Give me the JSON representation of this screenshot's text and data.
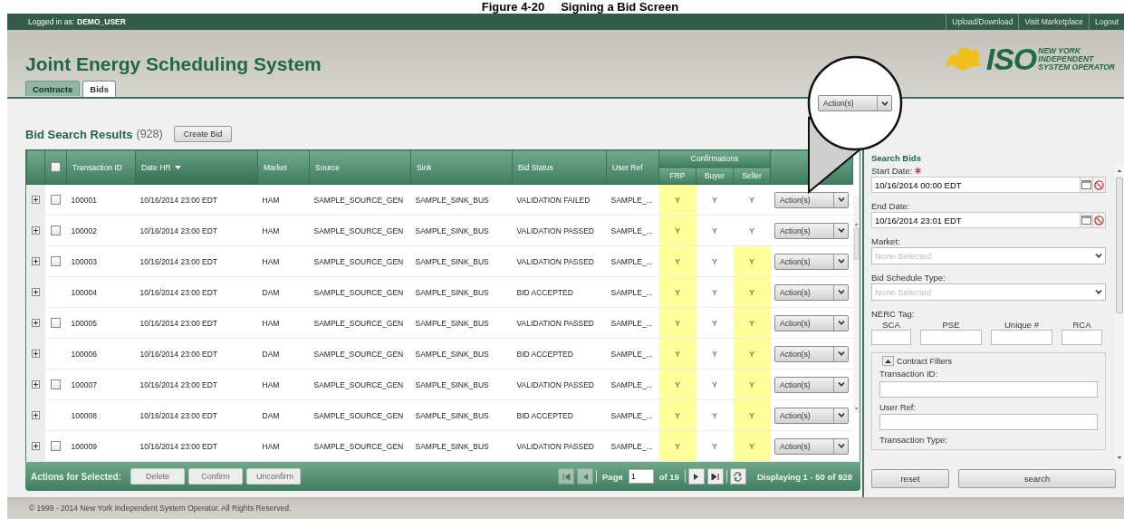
{
  "caption": {
    "number": "Figure 4-20",
    "title": "Signing a Bid Screen"
  },
  "top_bar": {
    "login_label": "Logged in as:",
    "user": "DEMO_USER",
    "links": [
      "Upload/Download",
      "Visit Marketplace",
      "Logout"
    ]
  },
  "header": {
    "title": "Joint Energy Scheduling System",
    "logo": {
      "wordmark": "ISO",
      "lines": [
        "NEW YORK",
        "INDEPENDENT",
        "SYSTEM OPERATOR"
      ]
    }
  },
  "tabs": [
    {
      "label": "Contracts",
      "selected": false
    },
    {
      "label": "Bids",
      "selected": true
    }
  ],
  "results": {
    "title": "Bid Search Results",
    "count": "(928)",
    "create_button": "Create Bid"
  },
  "table": {
    "select_all_checked": false,
    "columns": [
      {
        "label": "Transaction ID",
        "sorted": false
      },
      {
        "label": "Date HR",
        "sorted": true
      },
      {
        "label": "Market",
        "sorted": false
      },
      {
        "label": "Source",
        "sorted": false
      },
      {
        "label": "Sink",
        "sorted": false
      },
      {
        "label": "Bid Status",
        "sorted": false
      },
      {
        "label": "User Ref",
        "sorted": false
      }
    ],
    "group": "Confirmations",
    "sub_columns": [
      "FRP",
      "Buyer",
      "Seller"
    ],
    "rows": [
      {
        "checkbox": {
          "checked": false
        },
        "cells": [
          "100001",
          "10/16/2014 23:00 EDT",
          "HAM",
          "SAMPLE_SOURCE_GEN",
          "SAMPLE_SINK_BUS",
          "VALIDATION FAILED",
          "SAMPLE_..."
        ],
        "confirmations": [
          {
            "value": "Y",
            "highlighted": true
          },
          {
            "value": "Y",
            "highlighted": false
          },
          {
            "value": "Y",
            "highlighted": false
          }
        ],
        "action": "Action(s)"
      },
      {
        "checkbox": {
          "checked": false
        },
        "cells": [
          "100002",
          "10/16/2014 23:00 EDT",
          "HAM",
          "SAMPLE_SOURCE_GEN",
          "SAMPLE_SINK_BUS",
          "VALIDATION PASSED",
          "SAMPLE_..."
        ],
        "confirmations": [
          {
            "value": "Y",
            "highlighted": true
          },
          {
            "value": "Y",
            "highlighted": false
          },
          {
            "value": "Y",
            "highlighted": false
          }
        ],
        "action": "Action(s)"
      },
      {
        "checkbox": {
          "checked": false
        },
        "cells": [
          "100003",
          "10/16/2014 23:00 EDT",
          "HAM",
          "SAMPLE_SOURCE_GEN",
          "SAMPLE_SINK_BUS",
          "VALIDATION PASSED",
          "SAMPLE_..."
        ],
        "confirmations": [
          {
            "value": "Y",
            "highlighted": true
          },
          {
            "value": "Y",
            "highlighted": false
          },
          {
            "value": "Y",
            "highlighted": true
          }
        ],
        "action": "Action(s)"
      },
      {
        "cells": [
          "100004",
          "10/16/2014 23:00 EDT",
          "DAM",
          "SAMPLE_SOURCE_GEN",
          "SAMPLE_SINK_BUS",
          "BID ACCEPTED",
          "SAMPLE_..."
        ],
        "confirmations": [
          {
            "value": "Y",
            "highlighted": true
          },
          {
            "value": "Y",
            "highlighted": false
          },
          {
            "value": "Y",
            "highlighted": true
          }
        ],
        "action": "Action(s)"
      },
      {
        "checkbox": {
          "checked": false
        },
        "cells": [
          "100005",
          "10/16/2014 23:00 EDT",
          "HAM",
          "SAMPLE_SOURCE_GEN",
          "SAMPLE_SINK_BUS",
          "VALIDATION PASSED",
          "SAMPLE_..."
        ],
        "confirmations": [
          {
            "value": "Y",
            "highlighted": true
          },
          {
            "value": "Y",
            "highlighted": false
          },
          {
            "value": "Y",
            "highlighted": true
          }
        ],
        "action": "Action(s)"
      },
      {
        "cells": [
          "100006",
          "10/16/2014 23:00 EDT",
          "DAM",
          "SAMPLE_SOURCE_GEN",
          "SAMPLE_SINK_BUS",
          "BID ACCEPTED",
          "SAMPLE_..."
        ],
        "confirmations": [
          {
            "value": "Y",
            "highlighted": true
          },
          {
            "value": "Y",
            "highlighted": false
          },
          {
            "value": "Y",
            "highlighted": true
          }
        ],
        "action": "Action(s)"
      },
      {
        "checkbox": {
          "checked": false
        },
        "cells": [
          "100007",
          "10/16/2014 23:00 EDT",
          "HAM",
          "SAMPLE_SOURCE_GEN",
          "SAMPLE_SINK_BUS",
          "VALIDATION PASSED",
          "SAMPLE_..."
        ],
        "confirmations": [
          {
            "value": "Y",
            "highlighted": true
          },
          {
            "value": "Y",
            "highlighted": false
          },
          {
            "value": "Y",
            "highlighted": true
          }
        ],
        "action": "Action(s)"
      },
      {
        "cells": [
          "100008",
          "10/16/2014 23:00 EDT",
          "DAM",
          "SAMPLE_SOURCE_GEN",
          "SAMPLE_SINK_BUS",
          "BID ACCEPTED",
          "SAMPLE_..."
        ],
        "confirmations": [
          {
            "value": "Y",
            "highlighted": true
          },
          {
            "value": "Y",
            "highlighted": false
          },
          {
            "value": "Y",
            "highlighted": true
          }
        ],
        "action": "Action(s)"
      },
      {
        "checkbox": {
          "checked": false
        },
        "cells": [
          "100009",
          "10/16/2014 23:00 EDT",
          "HAM",
          "SAMPLE_SOURCE_GEN",
          "SAMPLE_SINK_BUS",
          "VALIDATION PASSED",
          "SAMPLE_..."
        ],
        "confirmations": [
          {
            "value": "Y",
            "highlighted": true
          },
          {
            "value": "Y",
            "highlighted": false
          },
          {
            "value": "Y",
            "highlighted": true
          }
        ],
        "action": "Action(s)"
      }
    ]
  },
  "table_footer": {
    "label": "Actions for Selected:",
    "buttons": [
      {
        "label": "Delete",
        "disabled": true
      },
      {
        "label": "Confirm",
        "disabled": true
      },
      {
        "label": "Unconfirm",
        "disabled": true
      }
    ],
    "pager": {
      "first_disabled": true,
      "prev_disabled": true,
      "page_label": "Page",
      "page": "1",
      "of": "of 19",
      "display": "Displaying 1 - 50 of 928"
    }
  },
  "search": {
    "title": "Search Bids",
    "fields": [
      {
        "kind": "date",
        "label": "Start Date:",
        "required": true,
        "value": "10/16/2014 00:00 EDT"
      },
      {
        "kind": "date",
        "label": "End Date:",
        "required": false,
        "value": "10/16/2014 23:01 EDT"
      },
      {
        "kind": "select",
        "label": "Market:",
        "placeholder": "None Selected"
      },
      {
        "kind": "select",
        "label": "Bid Schedule Type:",
        "placeholder": "None Selected"
      },
      {
        "kind": "multi",
        "label": "NERC Tag:",
        "parts": [
          "SCA",
          "PSE",
          "Unique #",
          "RCA"
        ]
      }
    ],
    "filters": {
      "legend": "Contract Filters",
      "expanded": true,
      "fields": [
        {
          "kind": "text",
          "label": "Transaction ID:"
        },
        {
          "kind": "text",
          "label": "User Ref:"
        },
        {
          "kind": "label",
          "label": "Transaction Type:"
        }
      ]
    },
    "buttons": [
      "reset",
      "search"
    ]
  },
  "callout": {
    "action": "Action(s)"
  },
  "footer": {
    "copyright": "© 1999 - 2014 New York Independent System Operator. All Rights Reserved."
  }
}
